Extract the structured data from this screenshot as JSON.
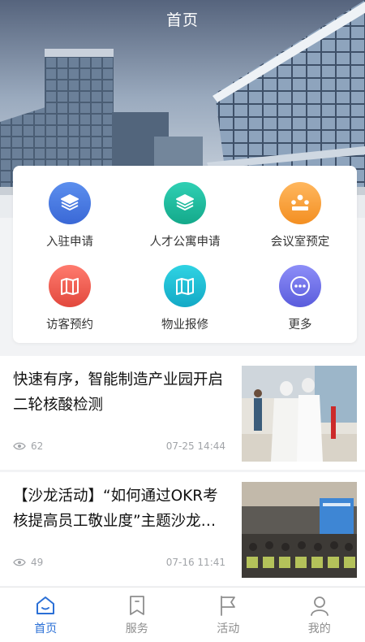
{
  "header": {
    "title": "首页"
  },
  "menu": {
    "items": [
      {
        "label": "入驻申请",
        "icon": "layers-icon",
        "color_top": "#5c8fee",
        "color_bottom": "#3a68d6"
      },
      {
        "label": "人才公寓申请",
        "icon": "layers-icon",
        "color_top": "#2fd0b4",
        "color_bottom": "#14a98a"
      },
      {
        "label": "会议室预定",
        "icon": "meeting-icon",
        "color_top": "#ffb75e",
        "color_bottom": "#f38f22"
      },
      {
        "label": "访客预约",
        "icon": "map-icon",
        "color_top": "#ff7b6e",
        "color_bottom": "#e2483d"
      },
      {
        "label": "物业报修",
        "icon": "map-icon",
        "color_top": "#2fd3e3",
        "color_bottom": "#13a9c6"
      },
      {
        "label": "更多",
        "icon": "more-icon",
        "color_top": "#8d8ef8",
        "color_bottom": "#5a5cdc"
      }
    ]
  },
  "news": [
    {
      "title": "快速有序，智能制造产业园开启二轮核酸检测",
      "views": "62",
      "date": "07-25 14:44"
    },
    {
      "title": "【沙龙活动】“如何通过OKR考核提高员工敬业度”主题沙龙活动",
      "views": "49",
      "date": "07-16 11:41"
    }
  ],
  "tabbar": {
    "active_color": "#2a6fd6",
    "items": [
      {
        "label": "首页",
        "icon": "home-icon",
        "active": true
      },
      {
        "label": "服务",
        "icon": "bookmark-icon",
        "active": false
      },
      {
        "label": "活动",
        "icon": "flag-icon",
        "active": false
      },
      {
        "label": "我的",
        "icon": "user-icon",
        "active": false
      }
    ]
  }
}
